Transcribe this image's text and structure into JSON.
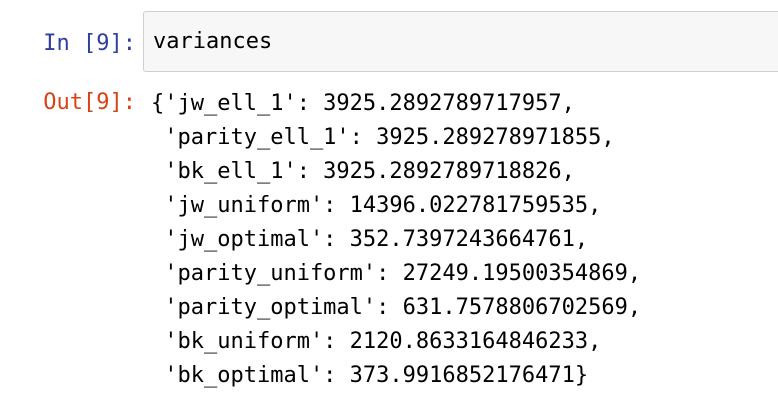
{
  "cell": {
    "input_prompt": "In [9]:",
    "input_code": "variances",
    "output_prompt": "Out[9]:",
    "output_lines": [
      "{'jw_ell_1': 3925.2892789717957,",
      " 'parity_ell_1': 3925.289278971855,",
      " 'bk_ell_1': 3925.2892789718826,",
      " 'jw_uniform': 14396.022781759535,",
      " 'jw_optimal': 352.7397243664761,",
      " 'parity_uniform': 27249.19500354869,",
      " 'parity_optimal': 631.7578806702569,",
      " 'bk_uniform': 2120.8633164846233,",
      " 'bk_optimal': 373.9916852176471}"
    ]
  },
  "colors": {
    "input_prompt": "#303F9F",
    "output_prompt": "#D84315",
    "input_background": "#f7f7f7",
    "input_border": "#cfcfcf"
  }
}
